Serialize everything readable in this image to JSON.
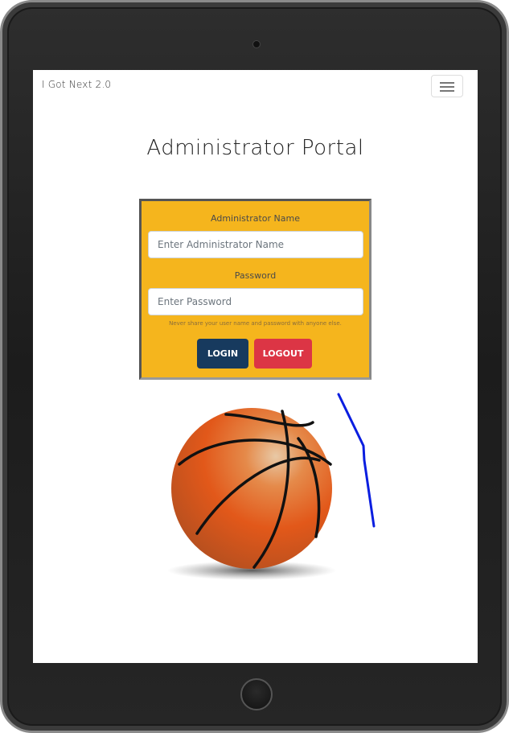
{
  "navbar": {
    "brand": "I Got Next 2.0",
    "menu_icon": "hamburger-menu-icon"
  },
  "page": {
    "title": "Administrator Portal"
  },
  "login_form": {
    "name_label": "Administrator Name",
    "name_placeholder": "Enter Administrator Name",
    "name_value": "",
    "password_label": "Password",
    "password_placeholder": "Enter Password",
    "password_value": "",
    "help_text": "Never share your user name and password with anyone else.",
    "login_label": "LOGIN",
    "logout_label": "LOGOUT"
  },
  "images": {
    "basketball": "basketball-image",
    "annotation": "blue-pen-scribble"
  },
  "colors": {
    "card_background": "#f5b51d",
    "login_button": "#173a5e",
    "logout_button": "#dc3545",
    "scribble": "#0a1ee0"
  }
}
